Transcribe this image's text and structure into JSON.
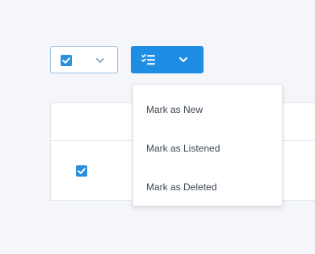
{
  "colors": {
    "accent": "#1e8ee4",
    "checkbox": "#2b8fdc",
    "select_border": "#9fc2e3",
    "menu_text": "#3e4852",
    "background": "#f4f6fa"
  },
  "toolbar": {
    "select_control": {
      "checked": true,
      "checkbox_icon": "checkbox-checked-icon",
      "chevron_icon": "chevron-down-icon"
    },
    "actions_button": {
      "icon": "list-checks-icon",
      "chevron_icon": "chevron-down-icon"
    }
  },
  "menu": {
    "items": [
      {
        "label": "Mark as New"
      },
      {
        "label": "Mark as Listened"
      },
      {
        "label": "Mark as Deleted"
      }
    ]
  },
  "table": {
    "rows": [
      {
        "checked": true,
        "checkbox_icon": "checkbox-checked-icon"
      }
    ]
  }
}
